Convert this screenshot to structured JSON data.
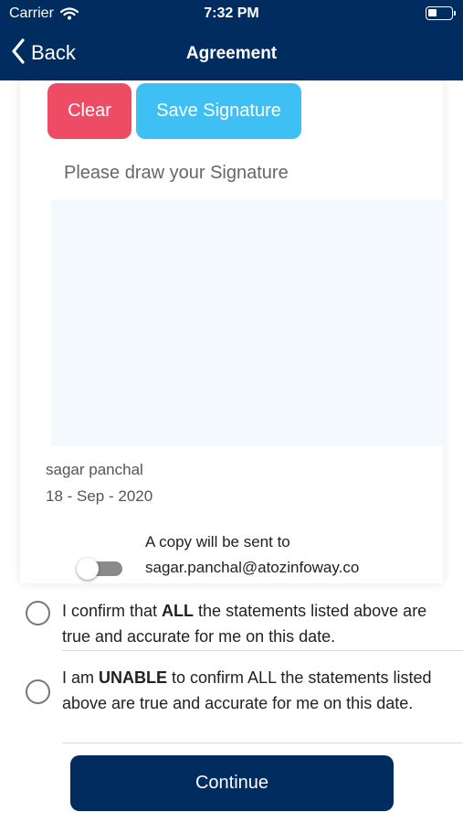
{
  "status_bar": {
    "carrier": "Carrier",
    "time": "7:32 PM",
    "wifi_icon": "wifi-icon",
    "battery_icon": "battery-icon"
  },
  "nav": {
    "back_label": "Back",
    "back_icon": "chevron-left-icon",
    "title": "Agreement",
    "bar_color": "#002c5f"
  },
  "signature": {
    "clear_label": "Clear",
    "save_label": "Save Signature",
    "hint": "Please draw your Signature",
    "name": "sagar panchal",
    "date": "18 - Sep - 2020",
    "clear_color": "#ee4c64",
    "save_color": "#3ec0f4"
  },
  "copy_email": {
    "enabled": false,
    "line1": "A copy will be sent to",
    "line2": "sagar.panchal@atozinfoway.co"
  },
  "options": [
    {
      "pre": "I confirm that ",
      "bold": "ALL",
      "post": " the statements listed above are true and accurate for me on this date.",
      "selected": false
    },
    {
      "pre": "I am ",
      "bold": "UNABLE",
      "post": " to confirm ALL the statements listed above are true and accurate for me on this date.",
      "selected": false
    }
  ],
  "continue_label": "Continue"
}
